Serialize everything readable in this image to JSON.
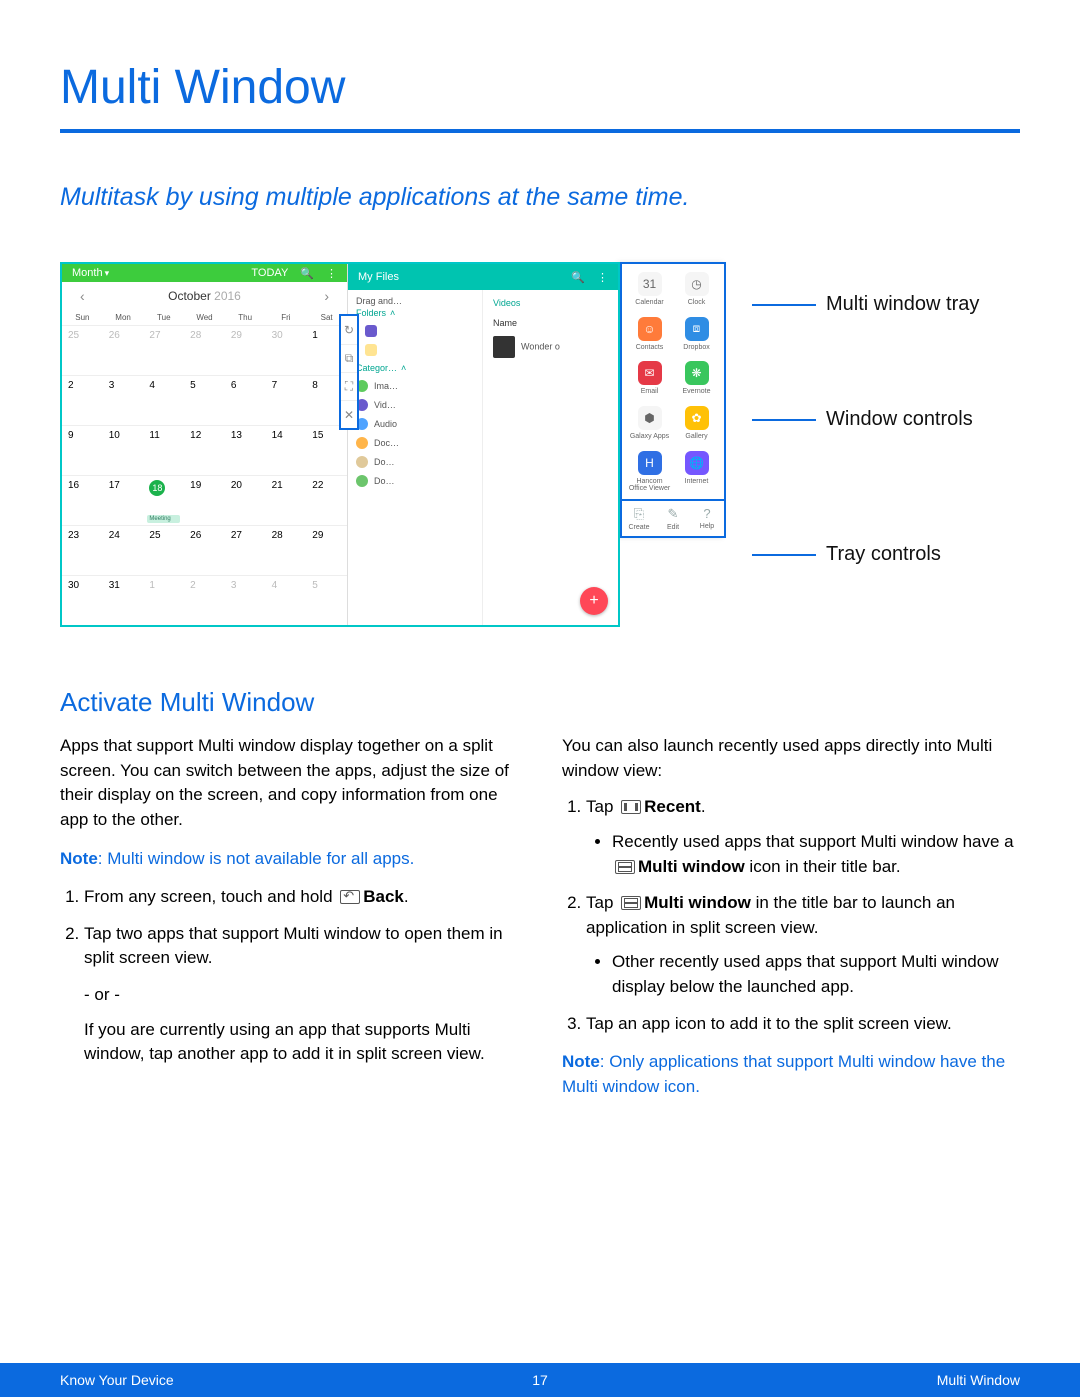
{
  "page": {
    "title": "Multi Window",
    "lead": "Multitask by using multiple applications at the same time."
  },
  "figure": {
    "calendar": {
      "view_label": "Month",
      "today_label": "TODAY",
      "month": "October",
      "year": "2016",
      "day_headers": [
        "Sun",
        "Mon",
        "Tue",
        "Wed",
        "Thu",
        "Fri",
        "Sat"
      ],
      "weeks": [
        [
          {
            "d": "25",
            "prev": true
          },
          {
            "d": "26",
            "prev": true
          },
          {
            "d": "27",
            "prev": true
          },
          {
            "d": "28",
            "prev": true
          },
          {
            "d": "29",
            "prev": true
          },
          {
            "d": "30",
            "prev": true
          },
          {
            "d": "1"
          }
        ],
        [
          {
            "d": "2"
          },
          {
            "d": "3"
          },
          {
            "d": "4"
          },
          {
            "d": "5"
          },
          {
            "d": "6"
          },
          {
            "d": "7"
          },
          {
            "d": "8"
          }
        ],
        [
          {
            "d": "9"
          },
          {
            "d": "10"
          },
          {
            "d": "11"
          },
          {
            "d": "12"
          },
          {
            "d": "13"
          },
          {
            "d": "14"
          },
          {
            "d": "15"
          }
        ],
        [
          {
            "d": "16"
          },
          {
            "d": "17"
          },
          {
            "d": "18",
            "today": true,
            "event": "Meeting"
          },
          {
            "d": "19"
          },
          {
            "d": "20"
          },
          {
            "d": "21"
          },
          {
            "d": "22"
          }
        ],
        [
          {
            "d": "23"
          },
          {
            "d": "24"
          },
          {
            "d": "25"
          },
          {
            "d": "26"
          },
          {
            "d": "27"
          },
          {
            "d": "28"
          },
          {
            "d": "29"
          }
        ],
        [
          {
            "d": "30"
          },
          {
            "d": "31"
          },
          {
            "d": "1",
            "next": true
          },
          {
            "d": "2",
            "next": true
          },
          {
            "d": "3",
            "next": true
          },
          {
            "d": "4",
            "next": true
          },
          {
            "d": "5",
            "next": true
          }
        ]
      ],
      "fab": "+"
    },
    "window_controls": [
      "↻",
      "⧉",
      "⛶",
      "✕"
    ],
    "files": {
      "app_title": "My Files",
      "left": {
        "recent_header": "Drag and…",
        "folders_header": "Folders",
        "categories_header": "Categor…",
        "items": [
          "Ima…",
          "Vid…",
          "Audio",
          "Doc…",
          "Do…",
          "Do…"
        ]
      },
      "right": {
        "recent_header": "Videos",
        "name_header": "Name",
        "item": "Wonder o"
      }
    },
    "tray": {
      "apps": [
        {
          "name": "Calendar",
          "bg": "#f5f5f5",
          "fg": "#666",
          "glyph": "31"
        },
        {
          "name": "Clock",
          "bg": "#f5f5f5",
          "fg": "#666",
          "glyph": "◷"
        },
        {
          "name": "Contacts",
          "bg": "#ff7b3a",
          "glyph": "☺"
        },
        {
          "name": "Dropbox",
          "bg": "#2f8de4",
          "glyph": "⧈"
        },
        {
          "name": "Email",
          "bg": "#e53946",
          "glyph": "✉"
        },
        {
          "name": "Evernote",
          "bg": "#39c65d",
          "glyph": "❋"
        },
        {
          "name": "Galaxy Apps",
          "bg": "#f5f5f5",
          "fg": "#666",
          "glyph": "⬢"
        },
        {
          "name": "Gallery",
          "bg": "#ffc107",
          "glyph": "✿"
        },
        {
          "name": "Hancom Office Viewer",
          "bg": "#2f6fe4",
          "glyph": "H"
        },
        {
          "name": "Internet",
          "bg": "#7557ff",
          "glyph": "🌐"
        }
      ],
      "controls": [
        {
          "glyph": "⎘",
          "label": "Create"
        },
        {
          "glyph": "✎",
          "label": "Edit"
        },
        {
          "glyph": "?",
          "label": "Help"
        }
      ]
    },
    "callouts": {
      "tray": "Multi window tray",
      "window_controls": "Window controls",
      "tray_controls": "Tray controls"
    }
  },
  "section": {
    "heading": "Activate Multi Window",
    "left": {
      "intro": "Apps that support Multi window display together on a split screen. You can switch between the apps, adjust the size of their display on the screen, and copy information from one app to the other.",
      "note_label": "Note",
      "note_text": ": Multi window is not available for all apps.",
      "step1_pre": "From any screen, touch and hold ",
      "step1_bold": "Back",
      "step1_post": ".",
      "step2": "Tap two apps that support Multi window to open them in split screen view.",
      "or": "- or -",
      "or_para": "If you are currently using an app that supports Multi window, tap another app to add it in split screen view."
    },
    "right": {
      "intro": "You can also launch recently used apps directly into Multi window view:",
      "step1_pre": "Tap ",
      "step1_bold": "Recent",
      "step1_post": ".",
      "step1_bullet_pre": "Recently used apps that support Multi window have a ",
      "step1_bullet_bold": "Multi window",
      "step1_bullet_post": " icon in their title bar.",
      "step2_pre": "Tap ",
      "step2_bold": "Multi window",
      "step2_post": " in the title bar to launch an application in split screen view.",
      "step2_bullet": "Other recently used apps that support Multi window display below the launched app.",
      "step3": "Tap an app icon to add it to the split screen view.",
      "note_label": "Note",
      "note_text": ": Only applications that support Multi window have the Multi window icon."
    }
  },
  "footer": {
    "left": "Know Your Device",
    "center": "17",
    "right": "Multi Window"
  }
}
